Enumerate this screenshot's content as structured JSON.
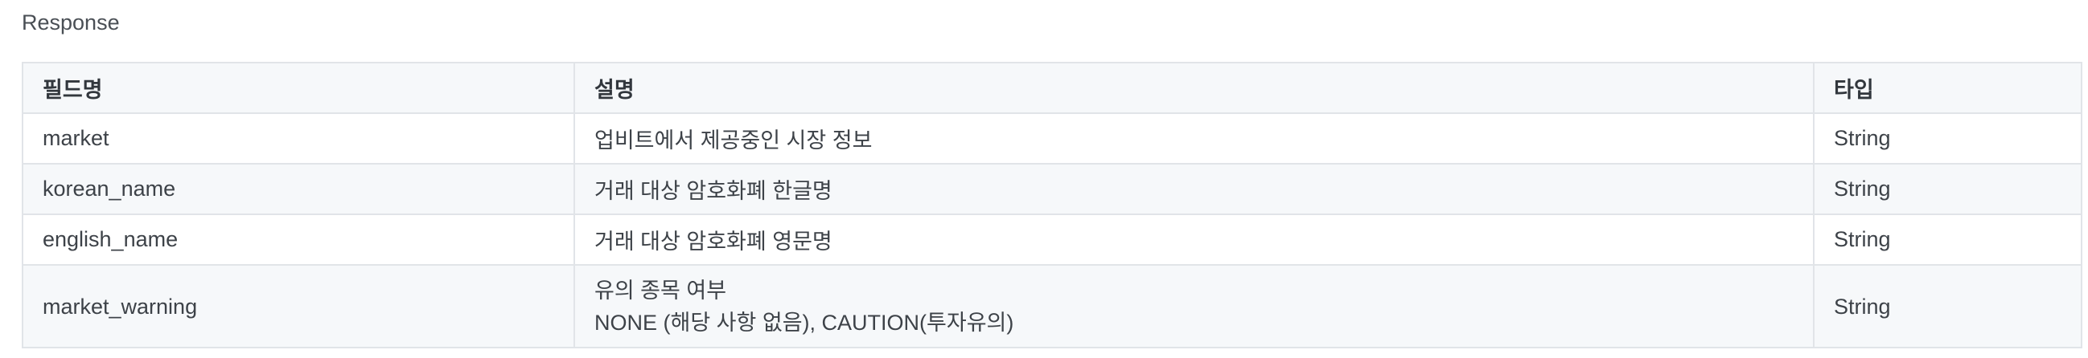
{
  "section": {
    "title": "Response"
  },
  "table": {
    "headers": [
      "필드명",
      "설명",
      "타입"
    ],
    "rows": [
      {
        "field": "market",
        "description": [
          "업비트에서 제공중인 시장 정보"
        ],
        "type": "String"
      },
      {
        "field": "korean_name",
        "description": [
          "거래 대상 암호화폐 한글명"
        ],
        "type": "String"
      },
      {
        "field": "english_name",
        "description": [
          "거래 대상 암호화폐 영문명"
        ],
        "type": "String"
      },
      {
        "field": "market_warning",
        "description": [
          "유의 종목 여부",
          "NONE (해당 사항 없음), CAUTION(투자유의)"
        ],
        "type": "String"
      }
    ]
  },
  "colors": {
    "header_bg": "#f6f8fa",
    "border": "#e1e4e8",
    "text": "#3d4248"
  }
}
